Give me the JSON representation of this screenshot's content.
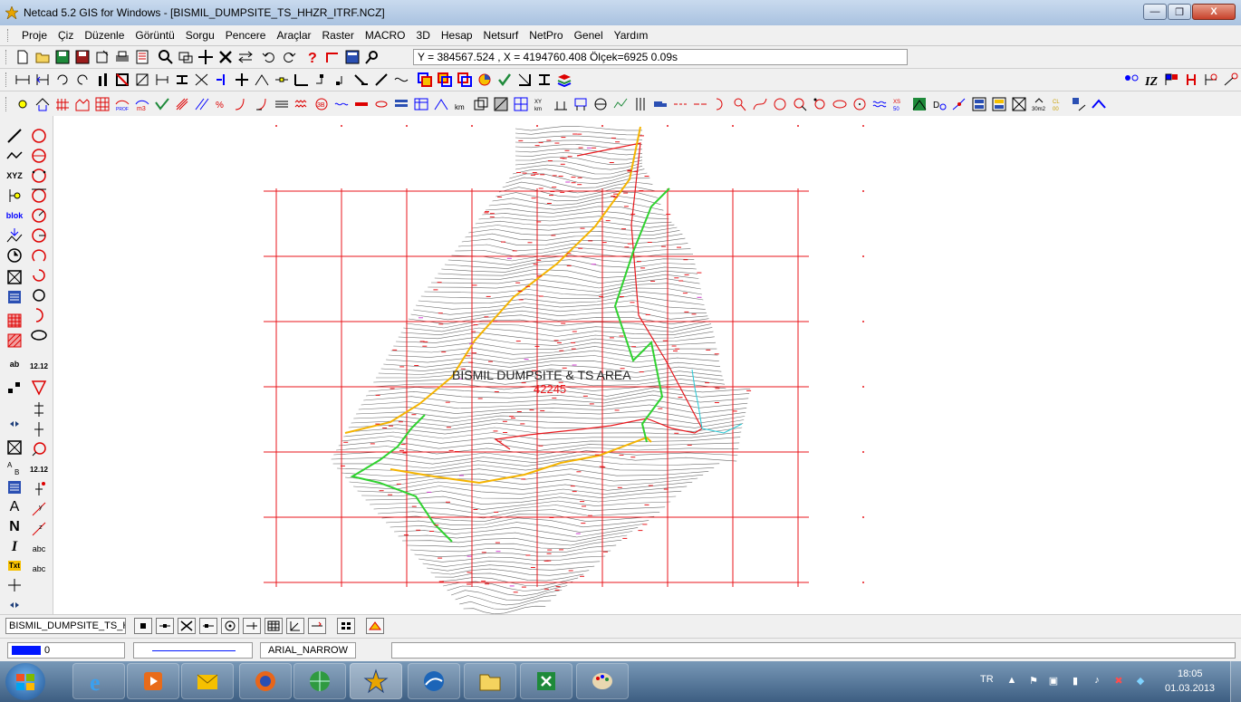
{
  "window": {
    "title": "Netcad 5.2 GIS for Windows - [BISMIL_DUMPSITE_TS_HHZR_ITRF.NCZ]",
    "minimize_glyph": "—",
    "restore_glyph": "❐",
    "close_glyph": "X"
  },
  "menu": {
    "items": [
      "Proje",
      "Çiz",
      "Düzenle",
      "Görüntü",
      "Sorgu",
      "Pencere",
      "Araçlar",
      "Raster",
      "MACRO",
      "3D",
      "Hesap",
      "Netsurf",
      "NetPro",
      "Genel",
      "Yardım"
    ]
  },
  "toolbar": {
    "coordinates": "Y = 384567.524 , X = 4194760.408  Ölçek=6925   0.09s"
  },
  "map": {
    "title": "BISMIL DUMPSITE & TS AREA",
    "label_number": "42245"
  },
  "left_tools": {
    "xyz_label": "XYZ",
    "blok_label": "blok",
    "ab_label": "ab",
    "num_label": "12.12",
    "num_label_2": "12.12",
    "a_letter": "A",
    "n_letter": "N",
    "i_letter": "I",
    "txt_label": "Txt",
    "abc_label": "abc",
    "abc_label_2": "abc"
  },
  "bottom": {
    "layer_name": "BISMIL_DUMPSITE_TS_H",
    "color_index": "0",
    "font_name": "ARIAL_NARROW"
  },
  "taskbar": {
    "language": "TR",
    "time": "18:05",
    "date": "01.03.2013"
  },
  "colors": {
    "grid_red": "#e8161b",
    "contour_gray": "#6a6a6a",
    "road_yellow": "#f5b400",
    "green_line": "#2fd22f",
    "layer_blue": "#0016ff"
  }
}
